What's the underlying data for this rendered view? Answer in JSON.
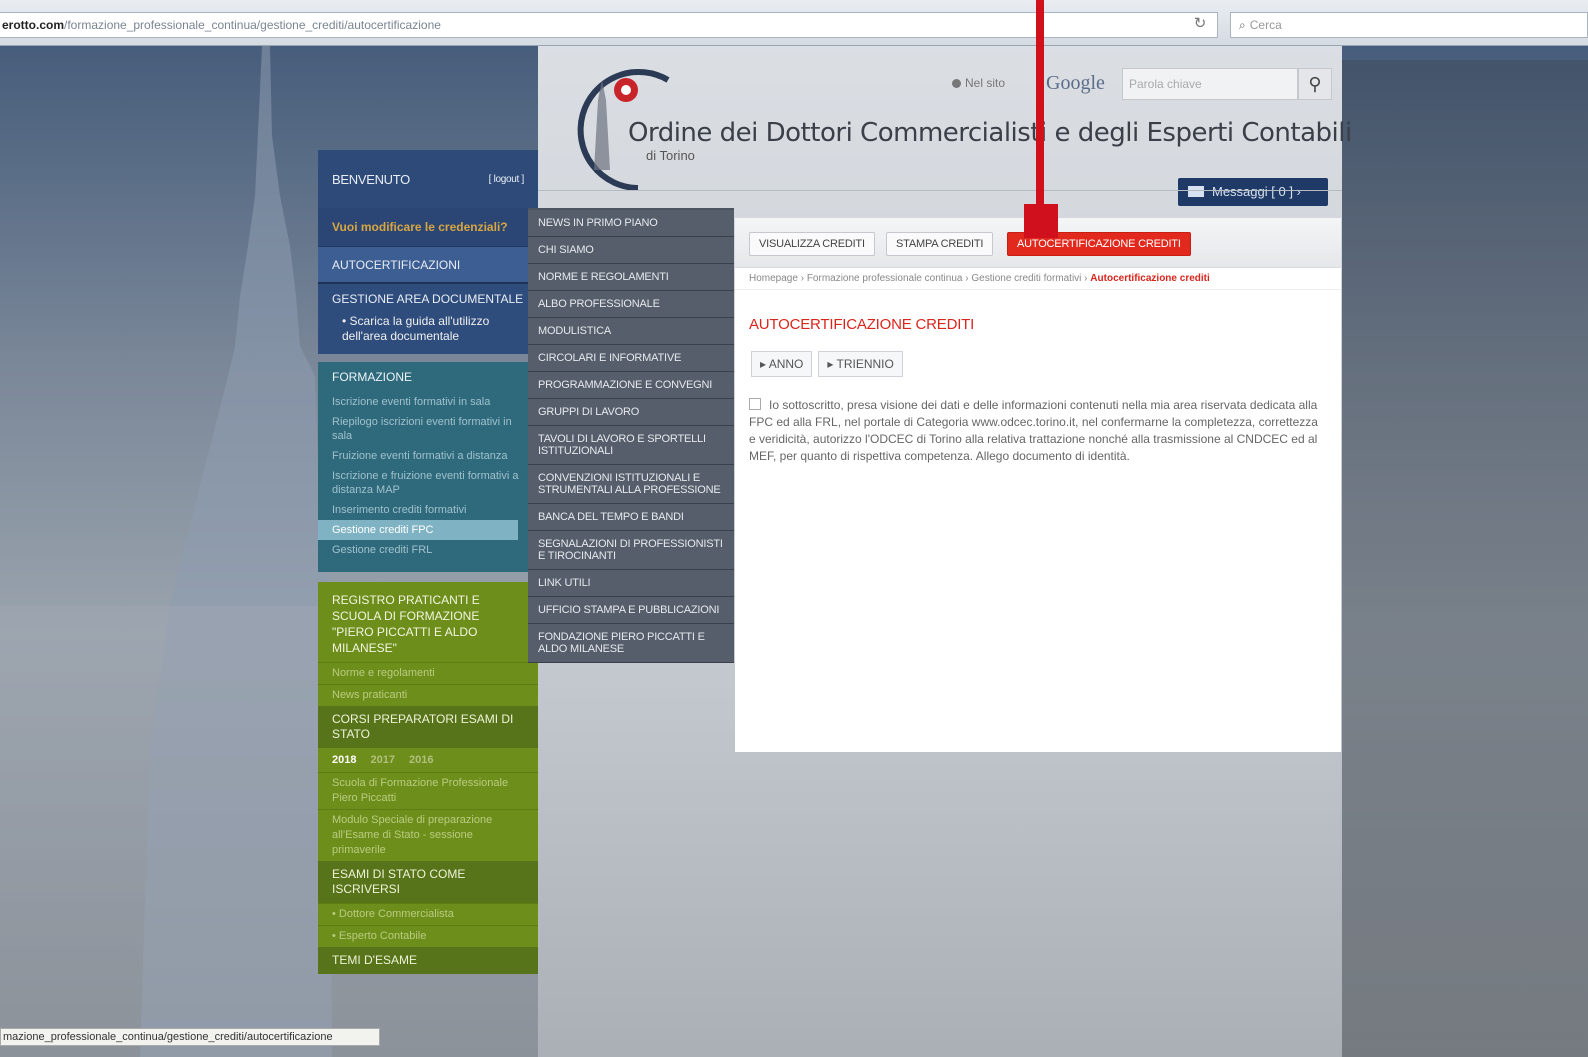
{
  "browser": {
    "url_domain": "erotto.com",
    "url_path": "/formazione_professionale_continua/gestione_crediti/autocertificazione",
    "search_placeholder": "Cerca",
    "status_url": "mazione_professionale_continua/gestione_crediti/autocertificazione"
  },
  "header": {
    "title": "Ordine dei Dottori Commercialisti e degli Esperti Contabili",
    "subtitle": "di Torino",
    "search_scope": "Nel sito",
    "google": "Google",
    "keyword_placeholder": "Parola chiave",
    "messages_label": "Messaggi [ 0 ] ›"
  },
  "sidebar": {
    "welcome": "BENVENUTO",
    "logout": "[ logout ]",
    "change_credentials": "Vuoi modificare le credenziali?",
    "autocert": "AUTOCERTIFICAZIONI",
    "doc_area": "GESTIONE AREA DOCUMENTALE",
    "doc_guide": "Scarica la guida all'utilizzo dell'area documentale",
    "formazione_title": "FORMAZIONE",
    "formazione_items": [
      "Iscrizione eventi formativi in sala",
      "Riepilogo iscrizioni eventi formativi in sala",
      "Fruizione eventi formativi a distanza",
      "Iscrizione e fruizione eventi formativi a distanza MAP",
      "Inserimento crediti formativi",
      "Gestione crediti FPC",
      "Gestione crediti FRL"
    ],
    "green_title": "REGISTRO PRATICANTI E SCUOLA DI FORMAZIONE \"PIERO PICCATTI E ALDO MILANESE\"",
    "green_items": [
      "Norme e regolamenti",
      "News praticanti"
    ],
    "corsi": "CORSI PREPARATORI ESAMI DI STATO",
    "years": [
      "2018",
      "2017",
      "2016"
    ],
    "scuola": "Scuola di Formazione Professionale Piero Piccatti",
    "modulo": "Modulo Speciale di preparazione all'Esame di Stato - sessione primaverile",
    "esami": "ESAMI DI STATO COME ISCRIVERSI",
    "esami_items": [
      "Dottore Commercialista",
      "Esperto Contabile"
    ],
    "bottom": "TEMI D'ESAME"
  },
  "centernav": [
    "NEWS IN PRIMO PIANO",
    "CHI SIAMO",
    "NORME E REGOLAMENTI",
    "ALBO PROFESSIONALE",
    "MODULISTICA",
    "CIRCOLARI E INFORMATIVE",
    "PROGRAMMAZIONE E CONVEGNI",
    "GRUPPI DI LAVORO",
    "TAVOLI DI LAVORO E SPORTELLI ISTITUZIONALI",
    "CONVENZIONI ISTITUZIONALI E STRUMENTALI ALLA PROFESSIONE",
    "BANCA DEL TEMPO E BANDI",
    "SEGNALAZIONI DI PROFESSIONISTI E TIROCINANTI",
    "LINK UTILI",
    "UFFICIO STAMPA E PUBBLICAZIONI",
    "FONDAZIONE PIERO PICCATTI E ALDO MILANESE"
  ],
  "content": {
    "tabs": [
      "VISUALIZZA CREDITI",
      "STAMPA CREDITI",
      "AUTOCERTIFICAZIONE CREDITI"
    ],
    "breadcrumb": [
      "Homepage",
      "Formazione professionale continua",
      "Gestione crediti formativi"
    ],
    "breadcrumb_current": "Autocertificazione crediti",
    "title": "AUTOCERTIFICAZIONE CREDITI",
    "subtabs": [
      "ANNO",
      "TRIENNIO"
    ],
    "declaration": "Io sottoscritto, presa visione dei dati e delle informazioni contenuti nella mia area riservata dedicata alla FPC ed alla FRL, nel portale di Categoria www.odcec.torino.it, nel confermarne la completezza, correttezza e veridicità, autorizzo l'ODCEC di Torino alla relativa trattazione nonché alla trasmissione al CNDCEC ed al MEF, per quanto di rispettiva competenza. Allego documento di identità."
  },
  "colors": {
    "accent_red": "#d8261c",
    "nav_blue": "#2d4a78",
    "teal": "#2f6a7c",
    "green": "#6e8e1c"
  }
}
